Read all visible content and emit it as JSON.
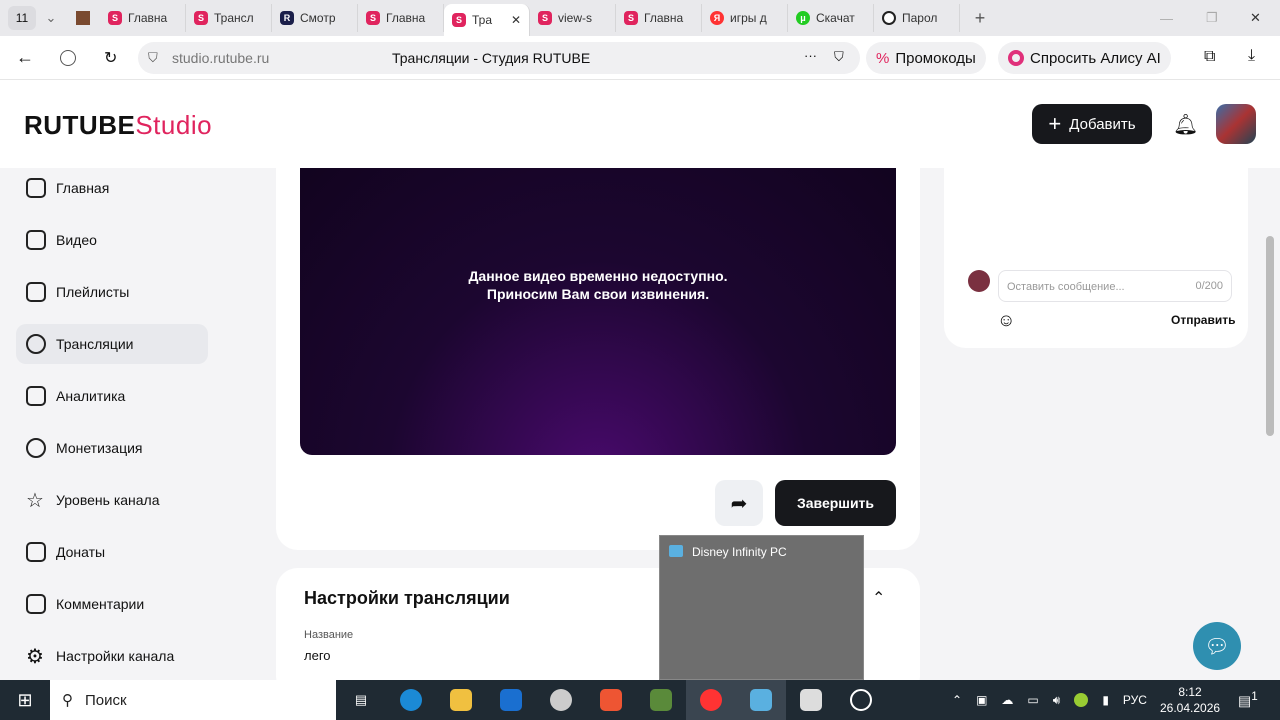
{
  "browser": {
    "tab_count": "11",
    "tabs": [
      {
        "label": "Главна"
      },
      {
        "label": "Трансл"
      },
      {
        "label": "Смотр"
      },
      {
        "label": "Главна"
      },
      {
        "label": "Тра"
      },
      {
        "label": "view-s"
      },
      {
        "label": "Главна"
      },
      {
        "label": "игры д"
      },
      {
        "label": "Скачат"
      },
      {
        "label": "Парол"
      }
    ],
    "url": "studio.rutube.ru",
    "page_title": "Трансляции - Студия RUTUBE",
    "promo": "Промокоды",
    "alice": "Спросить Алису AI"
  },
  "header": {
    "logo": "RUTUBE",
    "logo_suffix": "Studio",
    "add_label": "Добавить"
  },
  "sidebar": {
    "items": [
      {
        "label": "Главная"
      },
      {
        "label": "Видео"
      },
      {
        "label": "Плейлисты"
      },
      {
        "label": "Трансляции"
      },
      {
        "label": "Аналитика"
      },
      {
        "label": "Монетизация"
      },
      {
        "label": "Уровень канала"
      },
      {
        "label": "Донаты"
      },
      {
        "label": "Комментарии"
      },
      {
        "label": "Настройки канала"
      }
    ]
  },
  "player": {
    "line1": "Данное видео временно недоступно.",
    "line2": "Приносим Вам свои извинения.",
    "finish_label": "Завершить"
  },
  "chat": {
    "placeholder": "Оставить сообщение...",
    "counter": "0/200",
    "send_label": "Отправить"
  },
  "settings": {
    "title": "Настройки трансляции",
    "name_label": "Название",
    "name_value": "лего"
  },
  "popup": {
    "title": "Disney Infinity PC"
  },
  "taskbar": {
    "search": "Поиск",
    "lang": "РУС",
    "time": "8:12",
    "date": "26.04.2026",
    "notif": "1"
  }
}
